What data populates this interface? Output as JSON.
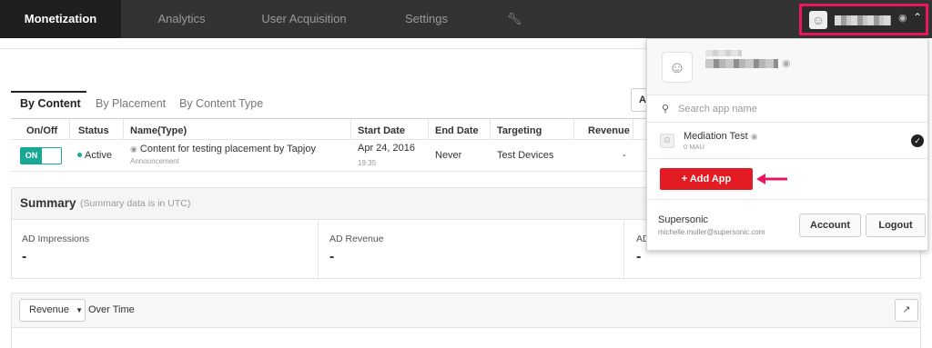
{
  "nav": {
    "tabs": [
      "Monetization",
      "Analytics",
      "User Acquisition",
      "Settings"
    ],
    "tools_icon": "wrench-icon",
    "app_selector": {
      "icon": "smiley-icon",
      "platform_icon": "android-icon",
      "caret": "chevron-up-icon"
    }
  },
  "subtabs": [
    "By Content",
    "By Placement",
    "By Content Type"
  ],
  "hidden_button": "A",
  "table": {
    "headers": [
      "On/Off",
      "Status",
      "Name(Type)",
      "Start Date",
      "End Date",
      "Targeting",
      "Revenue"
    ],
    "rows": [
      {
        "toggle": "ON",
        "status": "Active",
        "name": "Content for testing placement by Tapjoy",
        "type": "Announcement",
        "start_date": "Apr 24, 2016",
        "start_time": "19:35",
        "end_date": "Never",
        "targeting": "Test Devices",
        "revenue": "-"
      }
    ]
  },
  "summary": {
    "title": "Summary",
    "note": "(Summary data is in UTC)",
    "metrics": [
      {
        "label": "AD Impressions",
        "value": "-"
      },
      {
        "label": "AD Revenue",
        "value": "-"
      },
      {
        "label": "AD",
        "value": "-"
      }
    ]
  },
  "over_time": {
    "dropdown": "Revenue",
    "label": "Over Time",
    "share_icon": "share-icon"
  },
  "panel": {
    "search_placeholder": "Search app name",
    "apps": [
      {
        "name": "Mediation Test",
        "mau": "0 MAU",
        "selected": true
      }
    ],
    "add_app": "+ Add App",
    "org": "Supersonic",
    "email": "michelle.muller@supersonic.com",
    "account": "Account",
    "logout": "Logout"
  },
  "colors": {
    "accent_teal": "#19a796",
    "highlight_pink": "#e8185d",
    "add_red": "#e31b23",
    "nav_bg": "#333333"
  }
}
